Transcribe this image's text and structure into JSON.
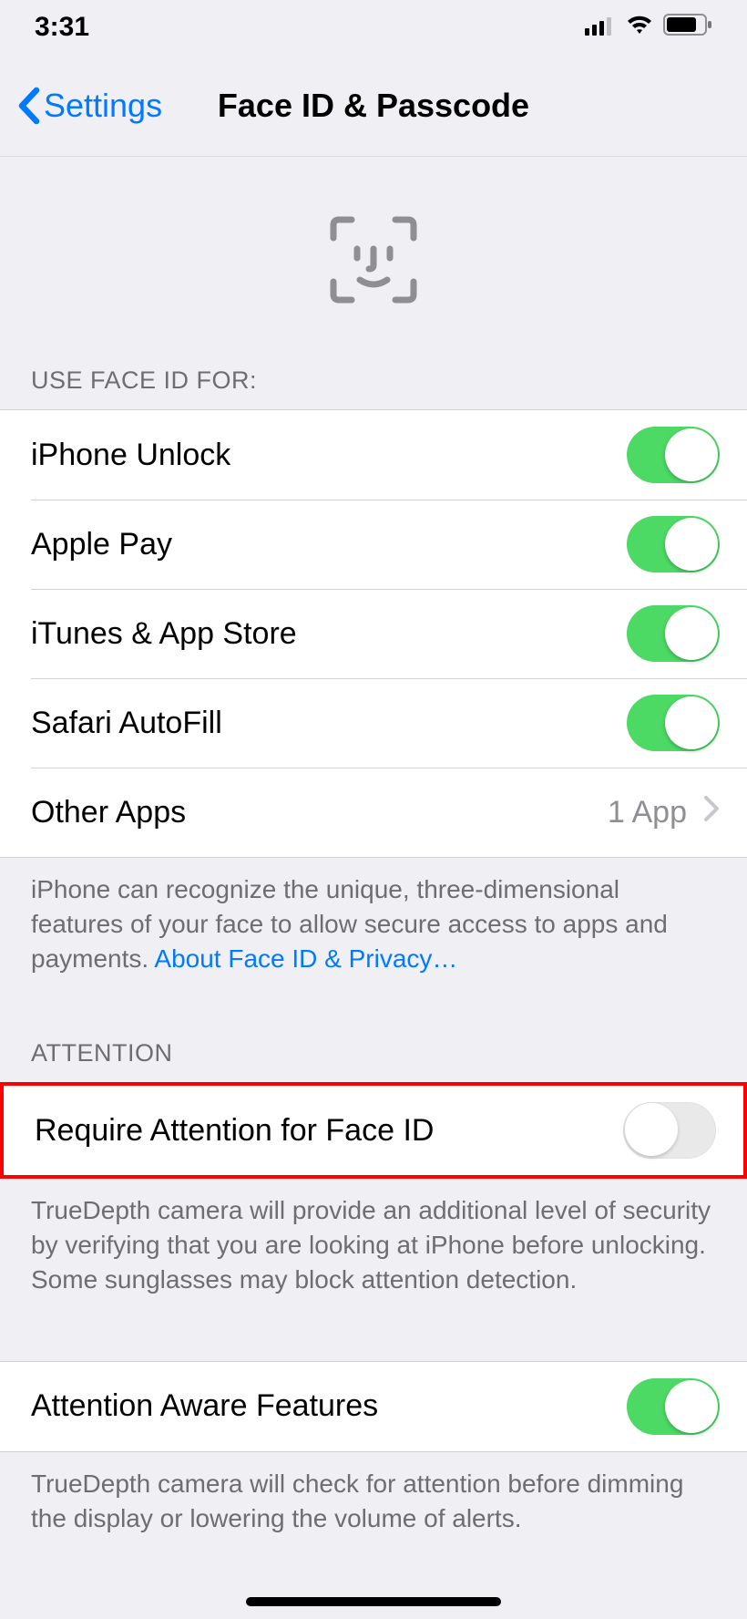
{
  "status_bar": {
    "time": "3:31"
  },
  "nav": {
    "back_label": "Settings",
    "title": "Face ID & Passcode"
  },
  "sections": {
    "use_face_id": {
      "header": "USE FACE ID FOR:",
      "items": [
        {
          "label": "iPhone Unlock",
          "enabled": true
        },
        {
          "label": "Apple Pay",
          "enabled": true
        },
        {
          "label": "iTunes & App Store",
          "enabled": true
        },
        {
          "label": "Safari AutoFill",
          "enabled": true
        }
      ],
      "other_apps": {
        "label": "Other Apps",
        "count_text": "1 App"
      },
      "footer_text": "iPhone can recognize the unique, three-dimensional features of your face to allow secure access to apps and payments. ",
      "footer_link": "About Face ID & Privacy…"
    },
    "attention": {
      "header": "ATTENTION",
      "require": {
        "label": "Require Attention for Face ID",
        "enabled": false
      },
      "require_footer": "TrueDepth camera will provide an additional level of security by verifying that you are looking at iPhone before unlocking. Some sunglasses may block attention detection.",
      "aware": {
        "label": "Attention Aware Features",
        "enabled": true
      },
      "aware_footer": "TrueDepth camera will check for attention before dimming the display or lowering the volume of alerts."
    }
  },
  "annotation": {
    "highlighted_row": "require-attention"
  }
}
